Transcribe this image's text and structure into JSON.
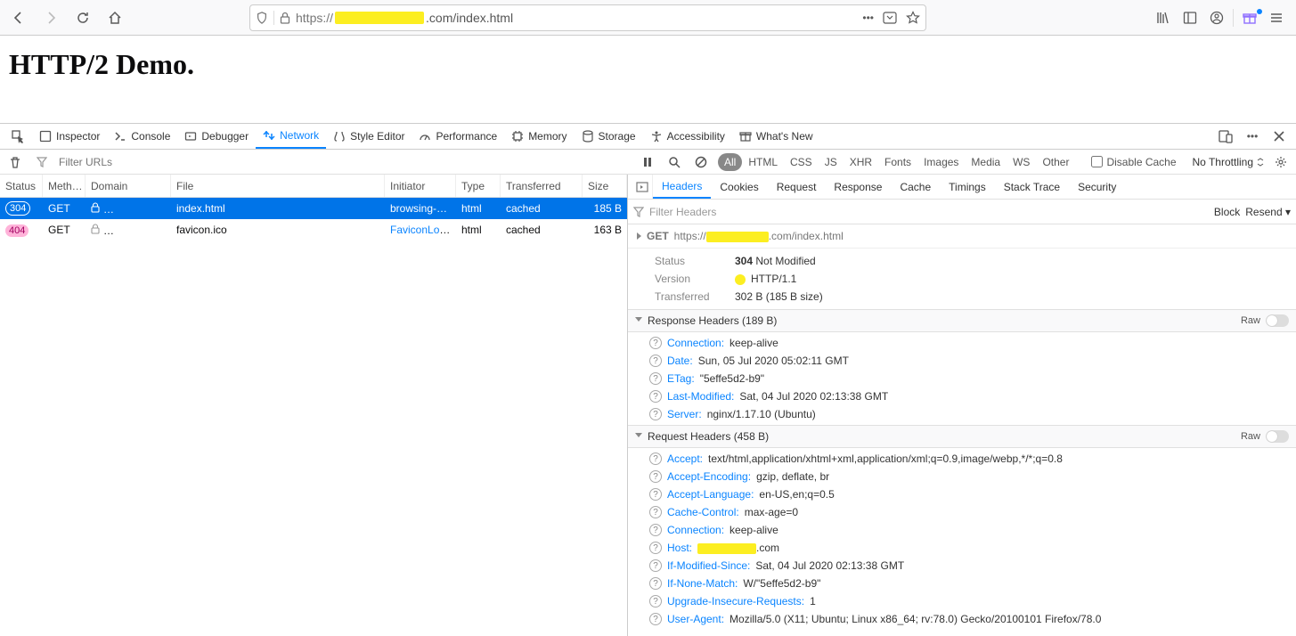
{
  "browser": {
    "url_proto": "https://",
    "url_suffix": ".com/index.html"
  },
  "page": {
    "title": "HTTP/2 Demo."
  },
  "devtools": {
    "tabs": [
      "Inspector",
      "Console",
      "Debugger",
      "Network",
      "Style Editor",
      "Performance",
      "Memory",
      "Storage",
      "Accessibility",
      "What's New"
    ],
    "active_tab": "Network"
  },
  "network_toolbar": {
    "filter_placeholder": "Filter URLs",
    "pills": [
      "All",
      "HTML",
      "CSS",
      "JS",
      "XHR",
      "Fonts",
      "Images",
      "Media",
      "WS",
      "Other"
    ],
    "disable_cache": "Disable Cache",
    "throttling": "No Throttling"
  },
  "net_columns": [
    "Status",
    "Meth…",
    "Domain",
    "File",
    "Initiator",
    "Type",
    "Transferred",
    "Size"
  ],
  "net_rows": [
    {
      "status": "304",
      "statusClass": "badge-304",
      "method": "GET",
      "file": "index.html",
      "initiator": "browsing-c…",
      "type": "html",
      "transferred": "cached",
      "size": "185 B",
      "selected": true
    },
    {
      "status": "404",
      "statusClass": "badge-404",
      "method": "GET",
      "file": "favicon.ico",
      "initiator": "FaviconLoa…",
      "type": "html",
      "transferred": "cached",
      "size": "163 B",
      "selected": false
    }
  ],
  "right_tabs": [
    "Headers",
    "Cookies",
    "Request",
    "Response",
    "Cache",
    "Timings",
    "Stack Trace",
    "Security"
  ],
  "right_filter": {
    "placeholder": "Filter Headers",
    "block": "Block",
    "resend": "Resend"
  },
  "summary": {
    "method": "GET",
    "url_prefix": "https://",
    "url_suffix": ".com/index.html",
    "rows": [
      {
        "label": "Status",
        "value_strong": "304",
        "value_rest": " Not Modified"
      },
      {
        "label": "Version",
        "value": "HTTP/1.1",
        "dot": true
      },
      {
        "label": "Transferred",
        "value": "302 B (185 B size)"
      }
    ]
  },
  "response_headers": {
    "title": "Response Headers (189 B)",
    "raw": "Raw",
    "rows": [
      {
        "k": "Connection:",
        "v": "keep-alive"
      },
      {
        "k": "Date:",
        "v": "Sun, 05 Jul 2020 05:02:11 GMT"
      },
      {
        "k": "ETag:",
        "v": "\"5effe5d2-b9\""
      },
      {
        "k": "Last-Modified:",
        "v": "Sat, 04 Jul 2020 02:13:38 GMT"
      },
      {
        "k": "Server:",
        "v": "nginx/1.17.10 (Ubuntu)"
      }
    ]
  },
  "request_headers": {
    "title": "Request Headers (458 B)",
    "raw": "Raw",
    "rows": [
      {
        "k": "Accept:",
        "v": "text/html,application/xhtml+xml,application/xml;q=0.9,image/webp,*/*;q=0.8"
      },
      {
        "k": "Accept-Encoding:",
        "v": "gzip, deflate, br"
      },
      {
        "k": "Accept-Language:",
        "v": "en-US,en;q=0.5"
      },
      {
        "k": "Cache-Control:",
        "v": "max-age=0"
      },
      {
        "k": "Connection:",
        "v": "keep-alive"
      },
      {
        "k": "Host:",
        "v": ".com",
        "redact": true
      },
      {
        "k": "If-Modified-Since:",
        "v": "Sat, 04 Jul 2020 02:13:38 GMT"
      },
      {
        "k": "If-None-Match:",
        "v": "W/\"5effe5d2-b9\""
      },
      {
        "k": "Upgrade-Insecure-Requests:",
        "v": "1"
      },
      {
        "k": "User-Agent:",
        "v": "Mozilla/5.0 (X11; Ubuntu; Linux x86_64; rv:78.0) Gecko/20100101 Firefox/78.0"
      }
    ]
  }
}
